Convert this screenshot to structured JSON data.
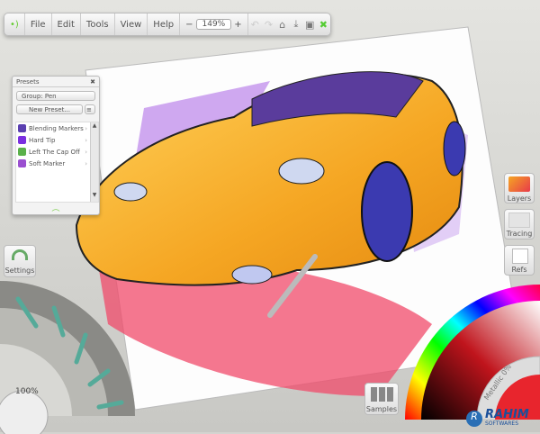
{
  "toolbar": {
    "menus": [
      "File",
      "Edit",
      "Tools",
      "View",
      "Help"
    ],
    "zoom": "149%",
    "zoom_out": "−",
    "zoom_in": "+"
  },
  "presets": {
    "title": "Presets",
    "group": "Group: Pen",
    "new_preset": "New Preset...",
    "items": [
      {
        "label": "Blending Markers",
        "color": "#5a3fb0"
      },
      {
        "label": "Hard Tip",
        "color": "#7a2fe0"
      },
      {
        "label": "Left The Cap Off",
        "color": "#5ab04a"
      },
      {
        "label": "Soft Marker",
        "color": "#9a4fd0"
      }
    ]
  },
  "right_panel": {
    "layers": "Layers",
    "tracing": "Tracing",
    "refs": "Refs"
  },
  "settings": "Settings",
  "tool_size": "100%",
  "samples": "Samples",
  "color": {
    "metallic": "Metallic 0%",
    "current": "#e8252d"
  },
  "watermark": {
    "name": "RAHIM",
    "sub": "SOFTWARES"
  }
}
